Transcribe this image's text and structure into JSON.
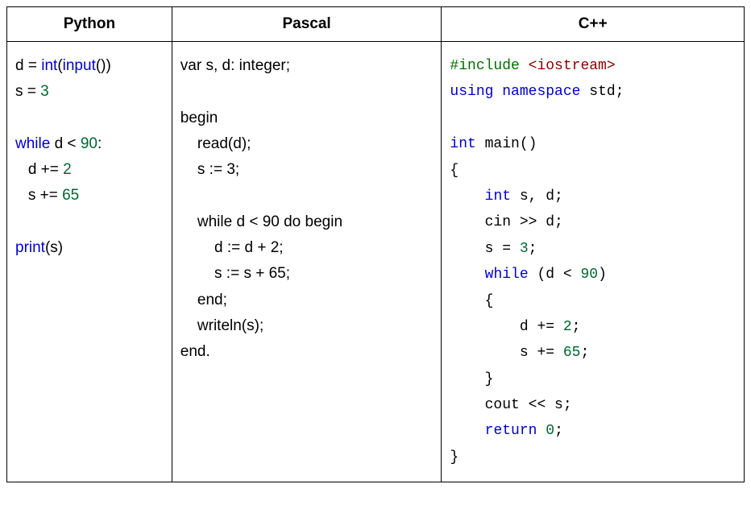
{
  "headers": {
    "python": "Python",
    "pascal": "Pascal",
    "cpp": "C++"
  },
  "code": {
    "python": {
      "l1a": "d = ",
      "l1b": "int",
      "l1c": "(",
      "l1d": "input",
      "l1e": "())",
      "l2a": "s = ",
      "l2b": "3",
      "blank1": " ",
      "l3a": "while",
      "l3b": " d < ",
      "l3c": "90",
      "l3d": ":",
      "l4a": "   d += ",
      "l4b": "2",
      "l5a": "   s += ",
      "l5b": "65",
      "blank2": " ",
      "l6a": "print",
      "l6b": "(s)"
    },
    "pascal": {
      "l1": "var s, d: integer;",
      "blank1": " ",
      "l2": "begin",
      "l3": "    read(d);",
      "l4": "    s := 3;",
      "blank2": " ",
      "l5": "    while d < 90 do begin",
      "l6": "        d := d + 2;",
      "l7": "        s := s + 65;",
      "l8": "    end;",
      "l9": "    writeln(s);",
      "l10": "end."
    },
    "cpp": {
      "l1a": "#include ",
      "l1b": "<iostream>",
      "l2a": "using",
      "l2b": " ",
      "l2c": "namespace",
      "l2d": " std;",
      "blank1": " ",
      "l3a": "int",
      "l3b": " main()",
      "l4": "{",
      "l5a": "    ",
      "l5b": "int",
      "l5c": " s, d;",
      "l6": "    cin >> d;",
      "l7a": "    s = ",
      "l7b": "3",
      "l7c": ";",
      "l8a": "    ",
      "l8b": "while",
      "l8c": " (d < ",
      "l8d": "90",
      "l8e": ")",
      "l9": "    {",
      "l10a": "        d += ",
      "l10b": "2",
      "l10c": ";",
      "l11a": "        s += ",
      "l11b": "65",
      "l11c": ";",
      "l12": "    }",
      "l13": "    cout << s;",
      "l14a": "    ",
      "l14b": "return",
      "l14c": " ",
      "l14d": "0",
      "l14e": ";",
      "l15": "}"
    }
  }
}
